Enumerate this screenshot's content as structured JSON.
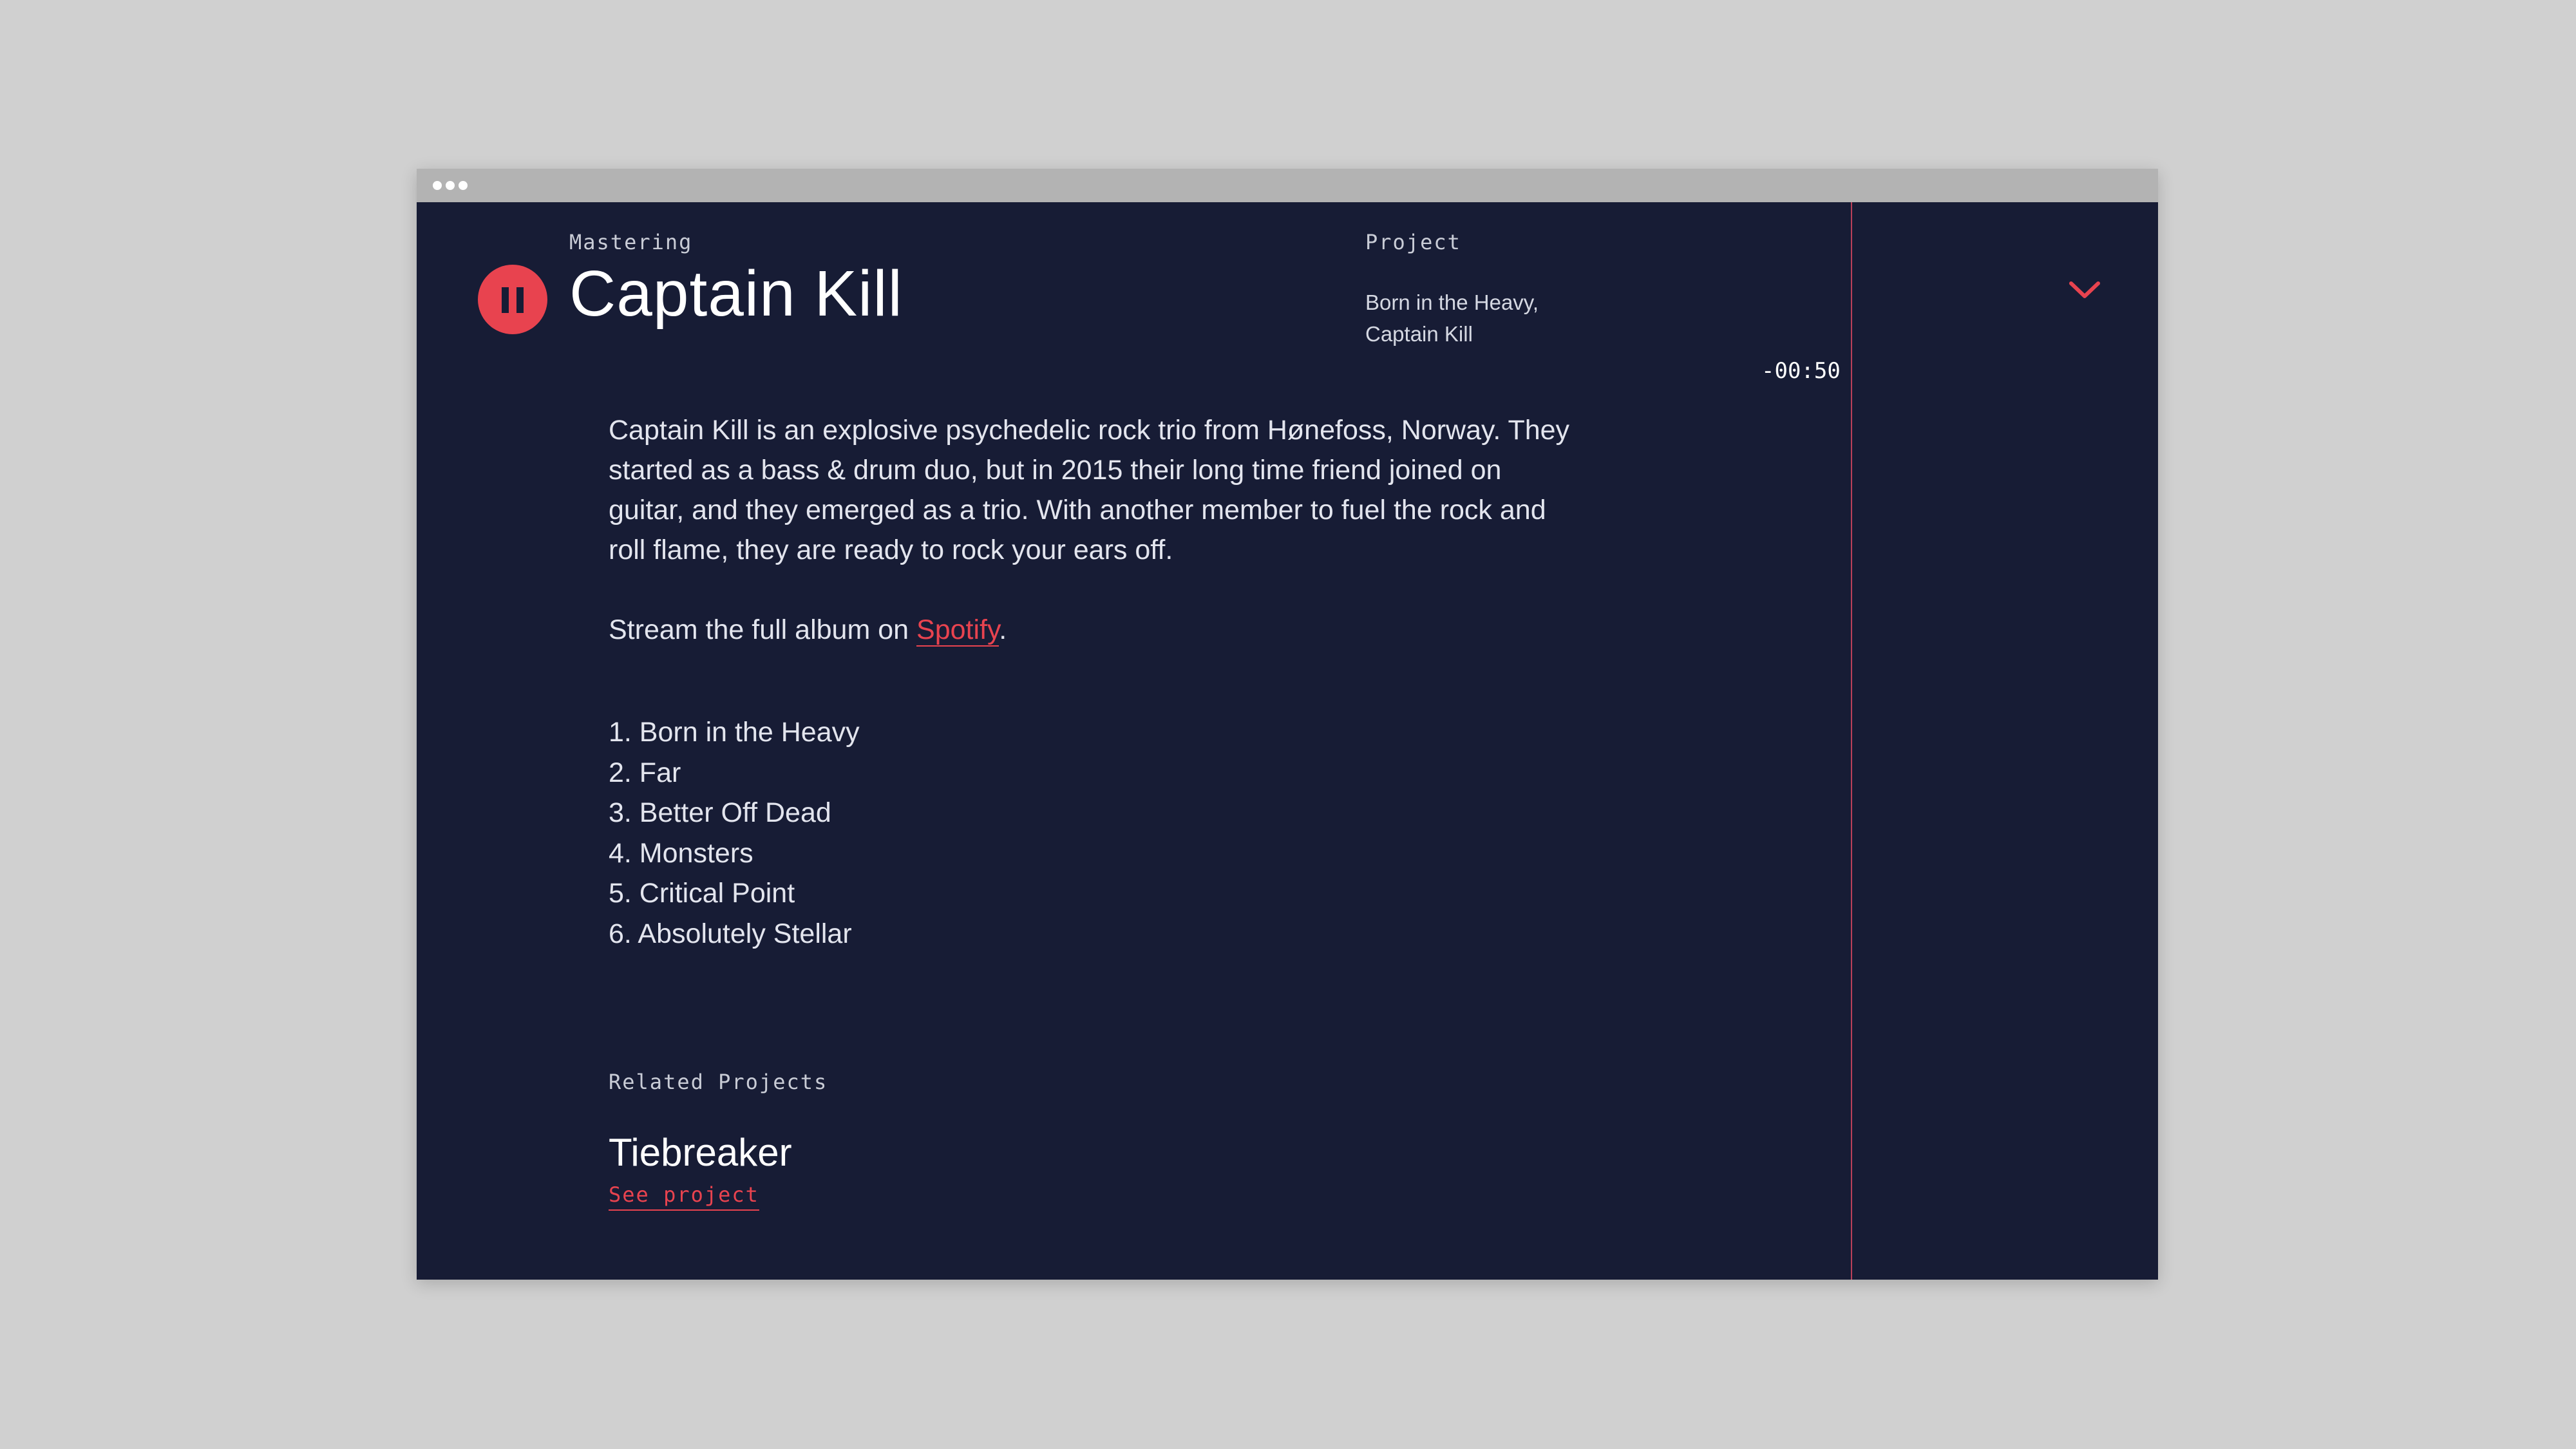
{
  "window": {
    "titlebar_dots": 3
  },
  "header": {
    "category_label": "Mastering",
    "title": "Captain Kill",
    "play_state": "pause-icon",
    "project_label": "Project",
    "project_name": "Born in the Heavy,\nCaptain Kill",
    "time_remaining": "-00:50",
    "collapse_icon": "chevron-down-icon"
  },
  "main": {
    "description": "Captain Kill is an explosive psychedelic rock trio from Hønefoss, Norway. They started as a bass & drum duo, but in 2015 their long time friend joined on guitar, and they emerged as a trio. With another member to fuel the rock and roll flame, they are ready to rock your ears off.",
    "stream_prefix": "Stream the full album on ",
    "stream_link": "Spotify",
    "stream_suffix": ".",
    "tracks": [
      "1. Born in the Heavy",
      "2. Far",
      "3. Better Off Dead",
      "4. Monsters",
      "5. Critical Point",
      "6. Absolutely Stellar"
    ]
  },
  "related": {
    "label": "Related Projects",
    "items": [
      {
        "title": "Tiebreaker",
        "link": "See project"
      }
    ]
  },
  "colors": {
    "background": "#d0d0d0",
    "panel": "#171c35",
    "accent": "#e8434f",
    "titlebar": "#b3b3b3"
  }
}
